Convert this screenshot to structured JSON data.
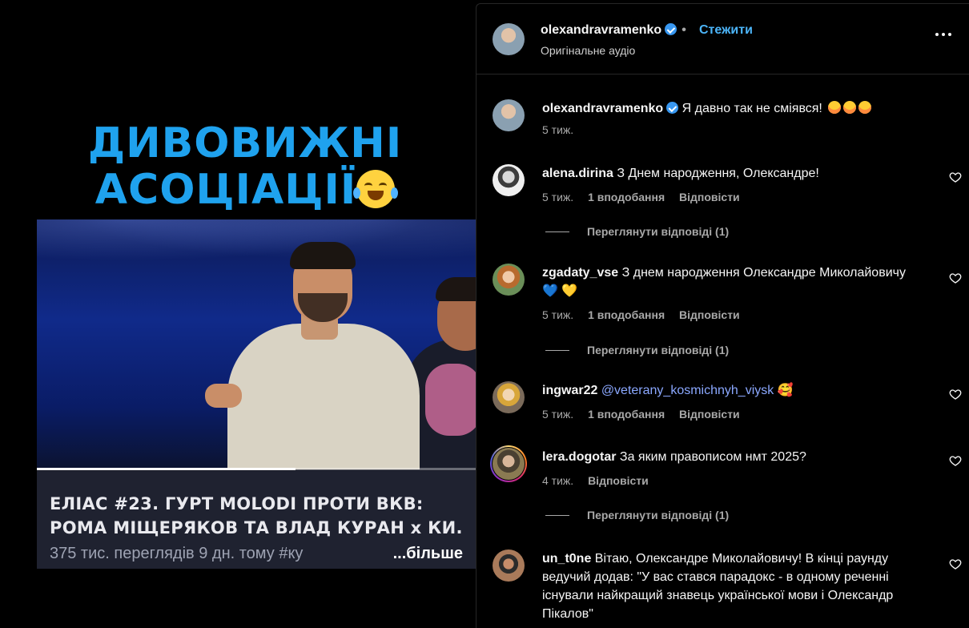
{
  "media": {
    "overlay_title_line1": "ДИВОВИЖНІ",
    "overlay_title_line2": "АСОЦІАЦІЇ",
    "progress": 0.59,
    "video_title_line1": "ЕЛІАС #23. ГУРТ MOLODI ПРОТИ ВКВ:",
    "video_title_line2": "РОМА МІЩЕРЯКОВ ТА ВЛАД КУРАН х КИ...",
    "video_meta": "375 тис. переглядів  9 дн. тому  #ку",
    "more_label": "...більше"
  },
  "header": {
    "username": "olexandravramenko",
    "separator": "•",
    "follow_label": "Стежити",
    "audio_label": "Оригінальне аудіо"
  },
  "comments": [
    {
      "username": "olexandravramenko",
      "text": "Я давно так не сміявся!",
      "time": "5 тиж."
    },
    {
      "username": "alena.dirina",
      "text": "З Днем народження, Олександре!",
      "time": "5 тиж.",
      "likes": "1 вподобання",
      "reply_label": "Відповісти",
      "view_replies": "Переглянути відповіді (1)"
    },
    {
      "username": "zgadaty_vse",
      "text": "З днем народження Олександре Миколайовичу",
      "emoji_line": "💙 💛",
      "time": "5 тиж.",
      "likes": "1 вподобання",
      "reply_label": "Відповісти",
      "view_replies": "Переглянути відповіді (1)"
    },
    {
      "username": "ingwar22",
      "mention": "@veterany_kosmichnyh_viysk",
      "emoji": "🥰",
      "time": "5 тиж.",
      "likes": "1 вподобання",
      "reply_label": "Відповісти"
    },
    {
      "username": "lera.dogotar",
      "text": "За яким правописом нмт 2025?",
      "time": "4 тиж.",
      "reply_label": "Відповісти",
      "view_replies": "Переглянути відповіді (1)"
    },
    {
      "username": "un_t0ne",
      "text": "Вітаю, Олександре Миколайовичу! В кінці раунду ведучий додав: \"У вас стався парадокс - в одному реченні існували найкращий знавець української мови і Олександр Пікалов\""
    }
  ],
  "colors": {
    "overlay_title": "#1fa2ee",
    "follow": "#4cb5f9",
    "verified": "#3897f0",
    "mention": "#8ba8ff"
  }
}
